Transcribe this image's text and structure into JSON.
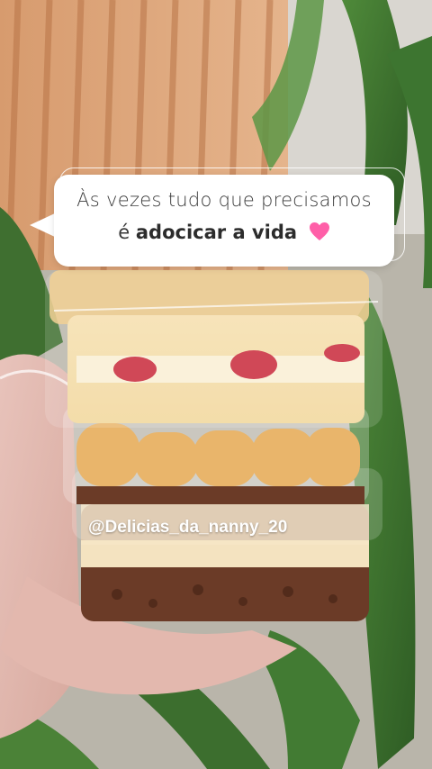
{
  "caption": {
    "line1": "Às vezes tudo que precisamos",
    "line2_prefix": "é",
    "line2_bold": "adocicar a vida",
    "emoji_name": "pink-heart-icon"
  },
  "watermark": {
    "handle": "@Delicias_da_nanny_20"
  },
  "colors": {
    "heart": "#ff5fa8",
    "bubble": "#ffffff",
    "text": "#3a3a3a"
  }
}
